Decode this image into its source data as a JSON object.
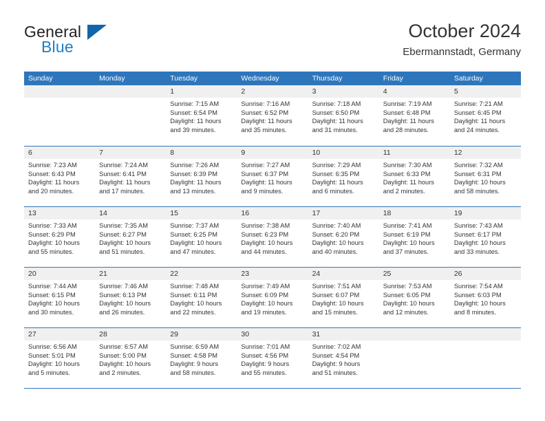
{
  "brand": {
    "name_part1": "General",
    "name_part2": "Blue",
    "triangle_icon": "triangle-logo-icon",
    "color_dark": "#231f20",
    "color_blue": "#1f7fc4",
    "color_triangle": "#1065ab"
  },
  "header": {
    "month_title": "October 2024",
    "location": "Ebermannstadt, Germany"
  },
  "theme": {
    "header_bg": "#2e76bc",
    "daynum_bg": "#f0f0f0",
    "grid_line": "#2e76bc",
    "text": "#333333"
  },
  "calendar": {
    "weekday_headers": [
      "Sunday",
      "Monday",
      "Tuesday",
      "Wednesday",
      "Thursday",
      "Friday",
      "Saturday"
    ],
    "weeks": [
      [
        {
          "day": "",
          "lines": []
        },
        {
          "day": "",
          "lines": []
        },
        {
          "day": "1",
          "lines": [
            "Sunrise: 7:15 AM",
            "Sunset: 6:54 PM",
            "Daylight: 11 hours",
            "and 39 minutes."
          ]
        },
        {
          "day": "2",
          "lines": [
            "Sunrise: 7:16 AM",
            "Sunset: 6:52 PM",
            "Daylight: 11 hours",
            "and 35 minutes."
          ]
        },
        {
          "day": "3",
          "lines": [
            "Sunrise: 7:18 AM",
            "Sunset: 6:50 PM",
            "Daylight: 11 hours",
            "and 31 minutes."
          ]
        },
        {
          "day": "4",
          "lines": [
            "Sunrise: 7:19 AM",
            "Sunset: 6:48 PM",
            "Daylight: 11 hours",
            "and 28 minutes."
          ]
        },
        {
          "day": "5",
          "lines": [
            "Sunrise: 7:21 AM",
            "Sunset: 6:45 PM",
            "Daylight: 11 hours",
            "and 24 minutes."
          ]
        }
      ],
      [
        {
          "day": "6",
          "lines": [
            "Sunrise: 7:23 AM",
            "Sunset: 6:43 PM",
            "Daylight: 11 hours",
            "and 20 minutes."
          ]
        },
        {
          "day": "7",
          "lines": [
            "Sunrise: 7:24 AM",
            "Sunset: 6:41 PM",
            "Daylight: 11 hours",
            "and 17 minutes."
          ]
        },
        {
          "day": "8",
          "lines": [
            "Sunrise: 7:26 AM",
            "Sunset: 6:39 PM",
            "Daylight: 11 hours",
            "and 13 minutes."
          ]
        },
        {
          "day": "9",
          "lines": [
            "Sunrise: 7:27 AM",
            "Sunset: 6:37 PM",
            "Daylight: 11 hours",
            "and 9 minutes."
          ]
        },
        {
          "day": "10",
          "lines": [
            "Sunrise: 7:29 AM",
            "Sunset: 6:35 PM",
            "Daylight: 11 hours",
            "and 6 minutes."
          ]
        },
        {
          "day": "11",
          "lines": [
            "Sunrise: 7:30 AM",
            "Sunset: 6:33 PM",
            "Daylight: 11 hours",
            "and 2 minutes."
          ]
        },
        {
          "day": "12",
          "lines": [
            "Sunrise: 7:32 AM",
            "Sunset: 6:31 PM",
            "Daylight: 10 hours",
            "and 58 minutes."
          ]
        }
      ],
      [
        {
          "day": "13",
          "lines": [
            "Sunrise: 7:33 AM",
            "Sunset: 6:29 PM",
            "Daylight: 10 hours",
            "and 55 minutes."
          ]
        },
        {
          "day": "14",
          "lines": [
            "Sunrise: 7:35 AM",
            "Sunset: 6:27 PM",
            "Daylight: 10 hours",
            "and 51 minutes."
          ]
        },
        {
          "day": "15",
          "lines": [
            "Sunrise: 7:37 AM",
            "Sunset: 6:25 PM",
            "Daylight: 10 hours",
            "and 47 minutes."
          ]
        },
        {
          "day": "16",
          "lines": [
            "Sunrise: 7:38 AM",
            "Sunset: 6:23 PM",
            "Daylight: 10 hours",
            "and 44 minutes."
          ]
        },
        {
          "day": "17",
          "lines": [
            "Sunrise: 7:40 AM",
            "Sunset: 6:20 PM",
            "Daylight: 10 hours",
            "and 40 minutes."
          ]
        },
        {
          "day": "18",
          "lines": [
            "Sunrise: 7:41 AM",
            "Sunset: 6:19 PM",
            "Daylight: 10 hours",
            "and 37 minutes."
          ]
        },
        {
          "day": "19",
          "lines": [
            "Sunrise: 7:43 AM",
            "Sunset: 6:17 PM",
            "Daylight: 10 hours",
            "and 33 minutes."
          ]
        }
      ],
      [
        {
          "day": "20",
          "lines": [
            "Sunrise: 7:44 AM",
            "Sunset: 6:15 PM",
            "Daylight: 10 hours",
            "and 30 minutes."
          ]
        },
        {
          "day": "21",
          "lines": [
            "Sunrise: 7:46 AM",
            "Sunset: 6:13 PM",
            "Daylight: 10 hours",
            "and 26 minutes."
          ]
        },
        {
          "day": "22",
          "lines": [
            "Sunrise: 7:48 AM",
            "Sunset: 6:11 PM",
            "Daylight: 10 hours",
            "and 22 minutes."
          ]
        },
        {
          "day": "23",
          "lines": [
            "Sunrise: 7:49 AM",
            "Sunset: 6:09 PM",
            "Daylight: 10 hours",
            "and 19 minutes."
          ]
        },
        {
          "day": "24",
          "lines": [
            "Sunrise: 7:51 AM",
            "Sunset: 6:07 PM",
            "Daylight: 10 hours",
            "and 15 minutes."
          ]
        },
        {
          "day": "25",
          "lines": [
            "Sunrise: 7:53 AM",
            "Sunset: 6:05 PM",
            "Daylight: 10 hours",
            "and 12 minutes."
          ]
        },
        {
          "day": "26",
          "lines": [
            "Sunrise: 7:54 AM",
            "Sunset: 6:03 PM",
            "Daylight: 10 hours",
            "and 8 minutes."
          ]
        }
      ],
      [
        {
          "day": "27",
          "lines": [
            "Sunrise: 6:56 AM",
            "Sunset: 5:01 PM",
            "Daylight: 10 hours",
            "and 5 minutes."
          ]
        },
        {
          "day": "28",
          "lines": [
            "Sunrise: 6:57 AM",
            "Sunset: 5:00 PM",
            "Daylight: 10 hours",
            "and 2 minutes."
          ]
        },
        {
          "day": "29",
          "lines": [
            "Sunrise: 6:59 AM",
            "Sunset: 4:58 PM",
            "Daylight: 9 hours",
            "and 58 minutes."
          ]
        },
        {
          "day": "30",
          "lines": [
            "Sunrise: 7:01 AM",
            "Sunset: 4:56 PM",
            "Daylight: 9 hours",
            "and 55 minutes."
          ]
        },
        {
          "day": "31",
          "lines": [
            "Sunrise: 7:02 AM",
            "Sunset: 4:54 PM",
            "Daylight: 9 hours",
            "and 51 minutes."
          ]
        },
        {
          "day": "",
          "lines": []
        },
        {
          "day": "",
          "lines": []
        }
      ]
    ]
  }
}
